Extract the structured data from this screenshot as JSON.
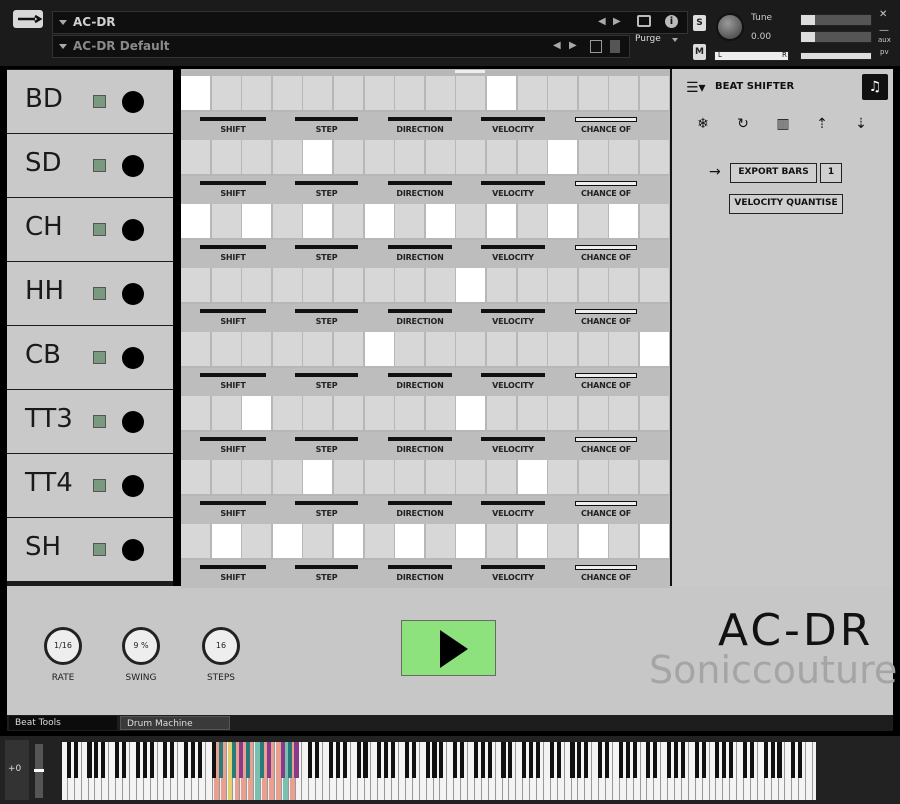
{
  "header": {
    "instrument": "AC-DR",
    "preset": "AC-DR Default",
    "purge": "Purge",
    "tune_label": "Tune",
    "tune_value": "0.00",
    "solo": "S",
    "mute": "M",
    "pan_left": "L",
    "pan_right": "R",
    "aux": "aux",
    "pv": "pv"
  },
  "tracks": [
    {
      "name": "BD",
      "steps": [
        1,
        0,
        0,
        0,
        0,
        0,
        0,
        0,
        0,
        0,
        1,
        0,
        0,
        0,
        0,
        0
      ]
    },
    {
      "name": "SD",
      "steps": [
        0,
        0,
        0,
        0,
        1,
        0,
        0,
        0,
        0,
        0,
        0,
        0,
        1,
        0,
        0,
        0
      ]
    },
    {
      "name": "CH",
      "steps": [
        1,
        0,
        1,
        0,
        1,
        0,
        1,
        0,
        1,
        0,
        1,
        0,
        1,
        0,
        1,
        0
      ]
    },
    {
      "name": "HH",
      "steps": [
        0,
        0,
        0,
        0,
        0,
        0,
        0,
        0,
        0,
        1,
        0,
        0,
        0,
        0,
        0,
        0
      ]
    },
    {
      "name": "CB",
      "steps": [
        0,
        0,
        0,
        0,
        0,
        0,
        1,
        0,
        0,
        0,
        0,
        0,
        0,
        0,
        0,
        1
      ]
    },
    {
      "name": "TT3",
      "steps": [
        0,
        0,
        1,
        0,
        0,
        0,
        0,
        0,
        0,
        1,
        0,
        0,
        0,
        0,
        0,
        0
      ]
    },
    {
      "name": "TT4",
      "steps": [
        0,
        0,
        0,
        0,
        1,
        0,
        0,
        0,
        0,
        0,
        0,
        1,
        0,
        0,
        0,
        0
      ]
    },
    {
      "name": "SH",
      "steps": [
        0,
        1,
        0,
        1,
        0,
        1,
        0,
        1,
        0,
        1,
        0,
        1,
        0,
        1,
        0,
        1
      ]
    }
  ],
  "track_controls": [
    "SHIFT",
    "STEP",
    "DIRECTION",
    "VELOCITY",
    "CHANCE OF"
  ],
  "right_panel": {
    "title": "BEAT SHIFTER",
    "export_label": "EXPORT BARS",
    "export_value": "1",
    "velocity_label": "VELOCITY QUANTISE"
  },
  "controls": {
    "rate_label": "RATE",
    "rate_value": "1/16",
    "swing_label": "SWING",
    "swing_value": "9 %",
    "steps_label": "STEPS",
    "steps_value": "16"
  },
  "brand": {
    "product": "AC-DR",
    "maker": "Soniccouture"
  },
  "tabs": [
    "Beat Tools",
    "Drum Machine"
  ],
  "keyboard": {
    "octave": "+0"
  }
}
